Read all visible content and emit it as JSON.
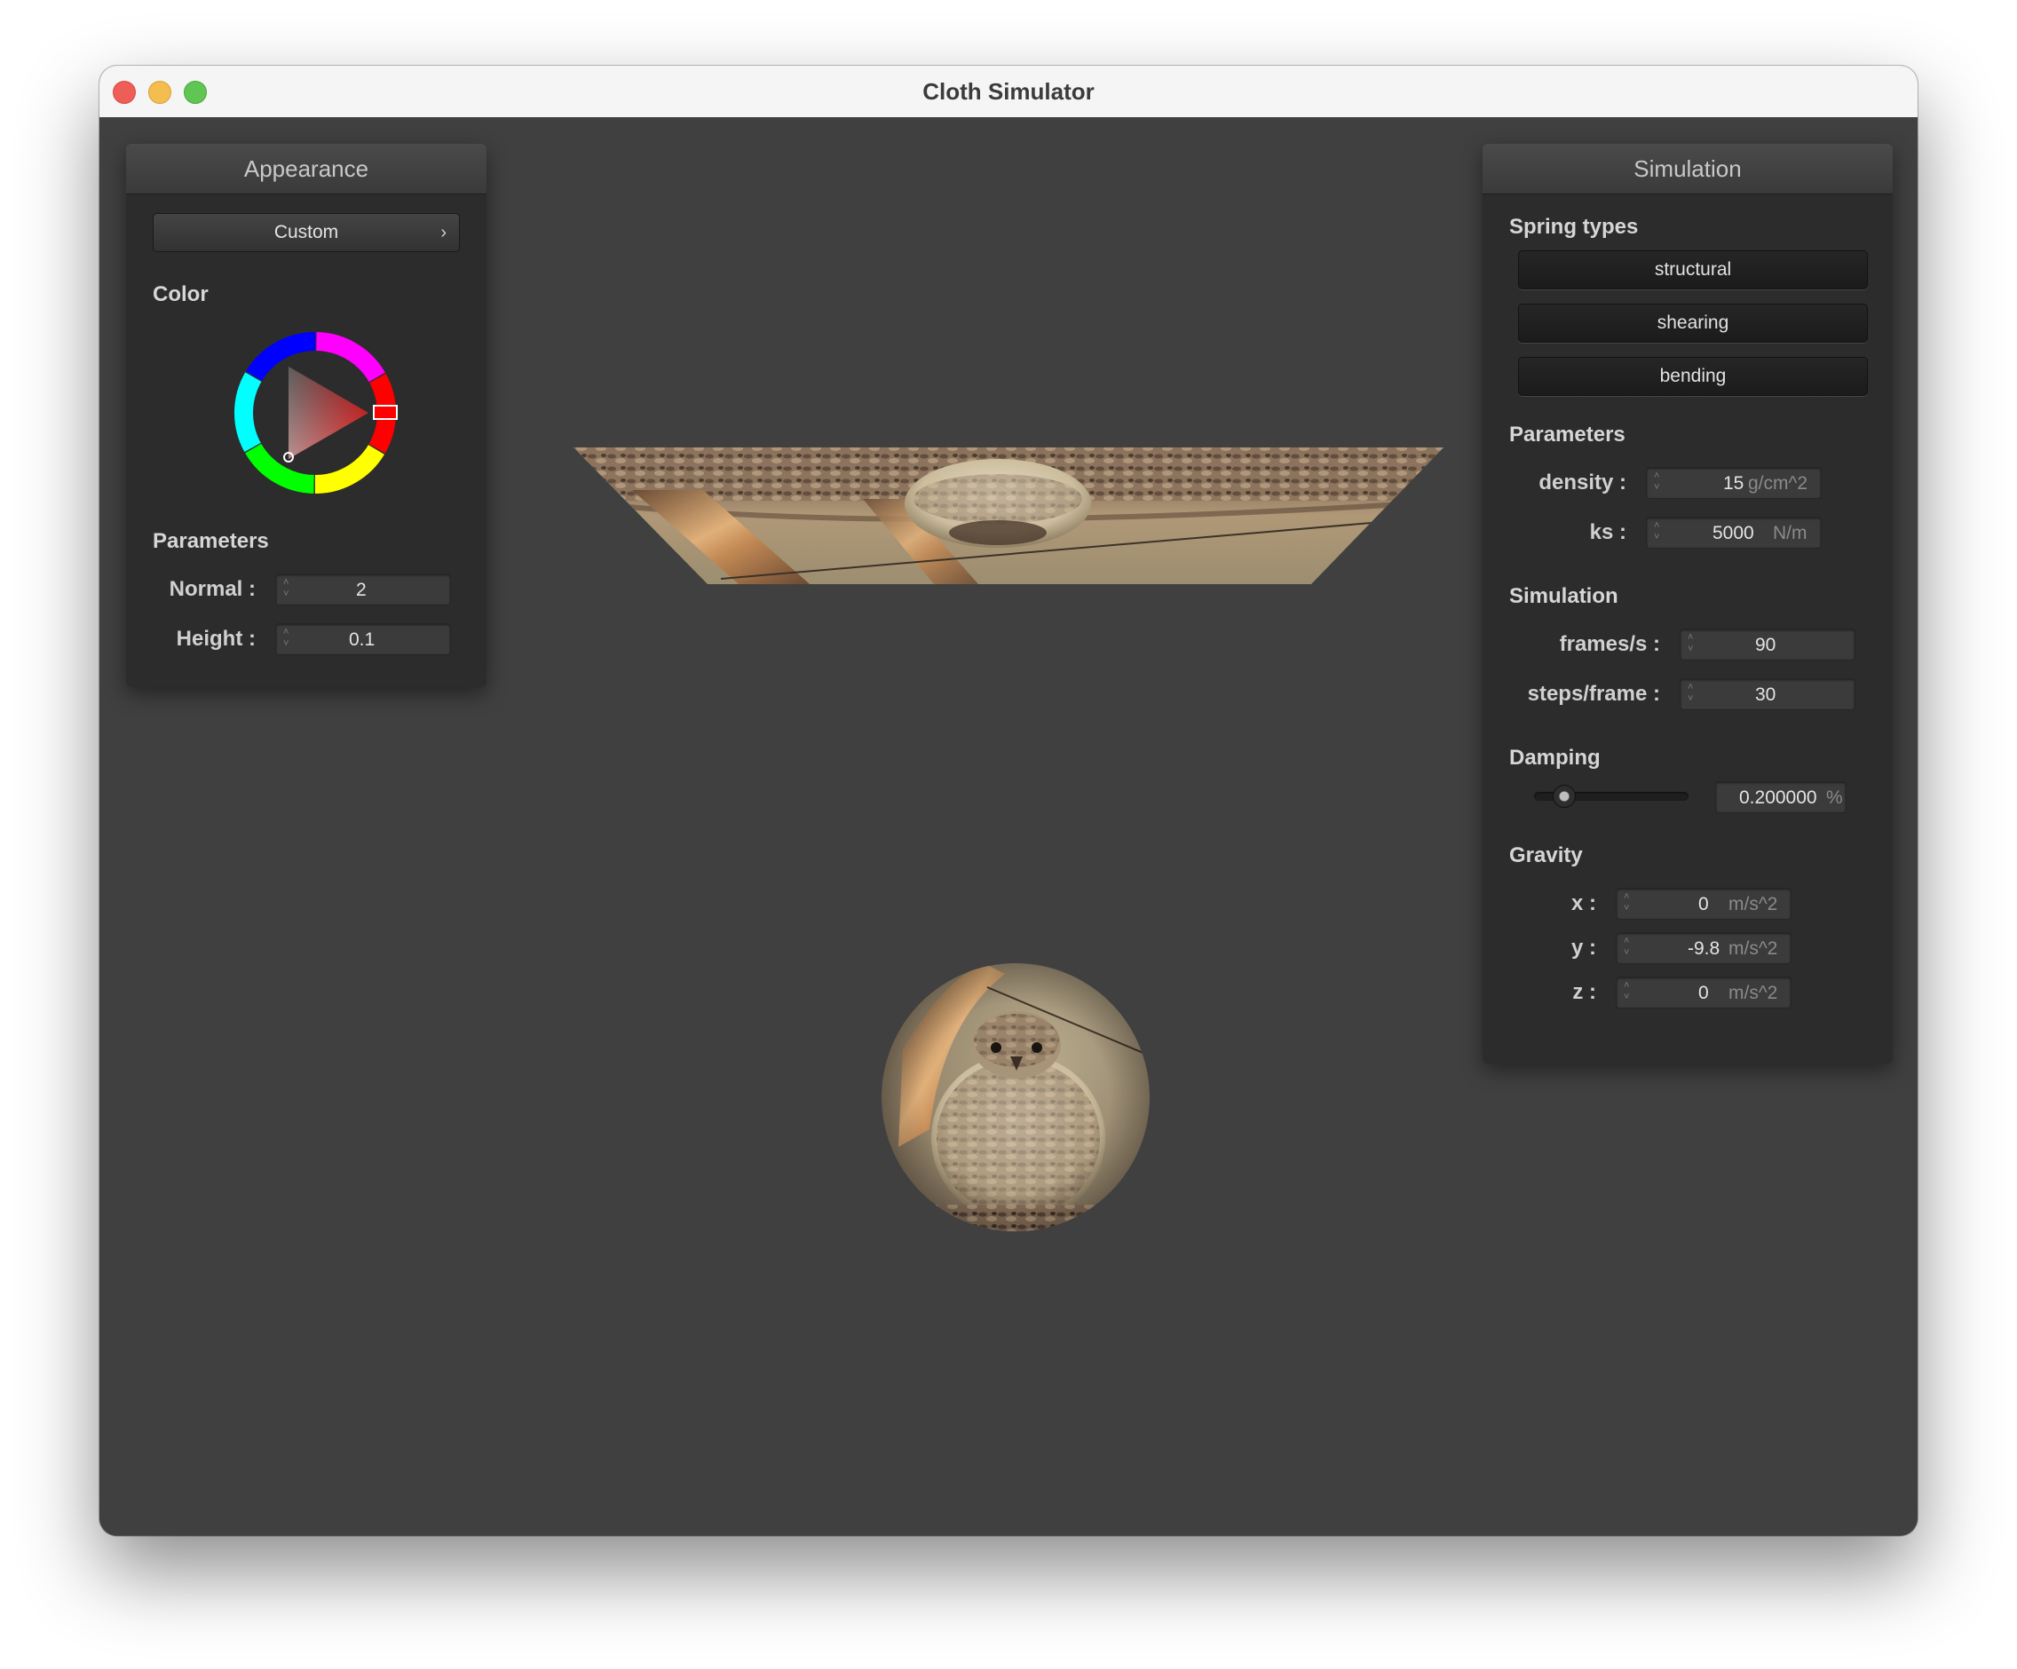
{
  "window": {
    "title": "Cloth Simulator"
  },
  "appearance": {
    "header": "Appearance",
    "preset_label": "Custom",
    "color_label": "Color",
    "parameters_label": "Parameters",
    "normal": {
      "label": "Normal :",
      "value": "2"
    },
    "height": {
      "label": "Height :",
      "value": "0.1"
    },
    "selected_color": "#ff0000"
  },
  "simulation": {
    "header": "Simulation",
    "spring_types_label": "Spring types",
    "spring_types": [
      "structural",
      "shearing",
      "bending"
    ],
    "parameters_label": "Parameters",
    "density": {
      "label": "density :",
      "value": "15",
      "unit": "g/cm^2"
    },
    "ks": {
      "label": "ks :",
      "value": "5000",
      "unit": "N/m"
    },
    "simulation_label": "Simulation",
    "frames_per_s": {
      "label": "frames/s :",
      "value": "90"
    },
    "steps_per_frame": {
      "label": "steps/frame :",
      "value": "30"
    },
    "damping_label": "Damping",
    "damping": {
      "value": "0.200000",
      "unit": "%",
      "slider_fraction": 0.2
    },
    "gravity_label": "Gravity",
    "gravity": [
      {
        "label": "x :",
        "value": "0",
        "unit": "m/s^2"
      },
      {
        "label": "y :",
        "value": "-9.8",
        "unit": "m/s^2"
      },
      {
        "label": "z :",
        "value": "0",
        "unit": "m/s^2"
      }
    ]
  }
}
